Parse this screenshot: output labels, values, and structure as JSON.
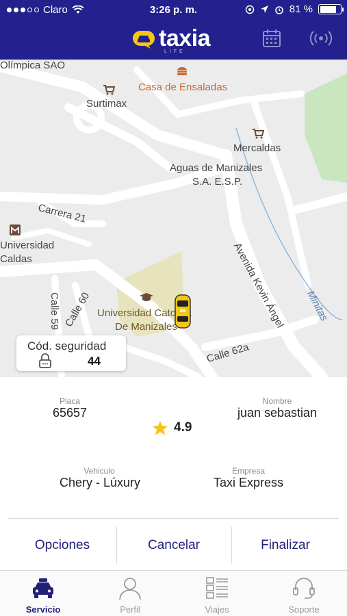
{
  "status_bar": {
    "carrier": "Claro",
    "time": "3:26 p. m.",
    "battery": "81 %",
    "battery_level": 0.81
  },
  "header": {
    "brand": "taxia",
    "brand_sub": "LIFE",
    "calendar_icon": "calendar-icon",
    "broadcast_icon": "broadcast-icon"
  },
  "map": {
    "labels": {
      "olimpica": "Olímpica SAO",
      "casa_ensaladas": "Casa de Ensaladas",
      "surtimax": "Surtimax",
      "mercaldas": "Mercaldas",
      "aguas_1": "Aguas de Manizales",
      "aguas_2": "S.A. E.S.P.",
      "carrera21": "Carrera 21",
      "univ_caldas_1": "Universidad",
      "univ_caldas_2": "Caldas",
      "calle59": "Calle 59",
      "calle60": "Calle 60",
      "univ_cat_1": "Universidad Catolica",
      "univ_cat_2": "De Manizales",
      "avenida": "Avenida Kevin Ángel",
      "minitas": "Minitas",
      "calle62a": "Calle 62a"
    },
    "security": {
      "title": "Cód. seguridad",
      "code": "44"
    }
  },
  "trip_info": {
    "placa_label": "Placa",
    "placa": "65657",
    "nombre_label": "Nombre",
    "nombre": "juan sebastian",
    "rating": "4.9",
    "vehiculo_label": "Vehiculo",
    "vehiculo": "Chery - Lúxury",
    "empresa_label": "Empresa",
    "empresa": "Taxi Express"
  },
  "actions": {
    "opciones": "Opciones",
    "cancelar": "Cancelar",
    "finalizar": "Finalizar"
  },
  "tabs": [
    {
      "label": "Servicio",
      "icon": "taxi-icon",
      "active": true
    },
    {
      "label": "Perfil",
      "icon": "user-icon",
      "active": false
    },
    {
      "label": "Viajes",
      "icon": "list-icon",
      "active": false
    },
    {
      "label": "Soporte",
      "icon": "headset-icon",
      "active": false
    }
  ],
  "colors": {
    "primary": "#22218d",
    "accent": "#f5c518",
    "action_text": "#22217a"
  }
}
